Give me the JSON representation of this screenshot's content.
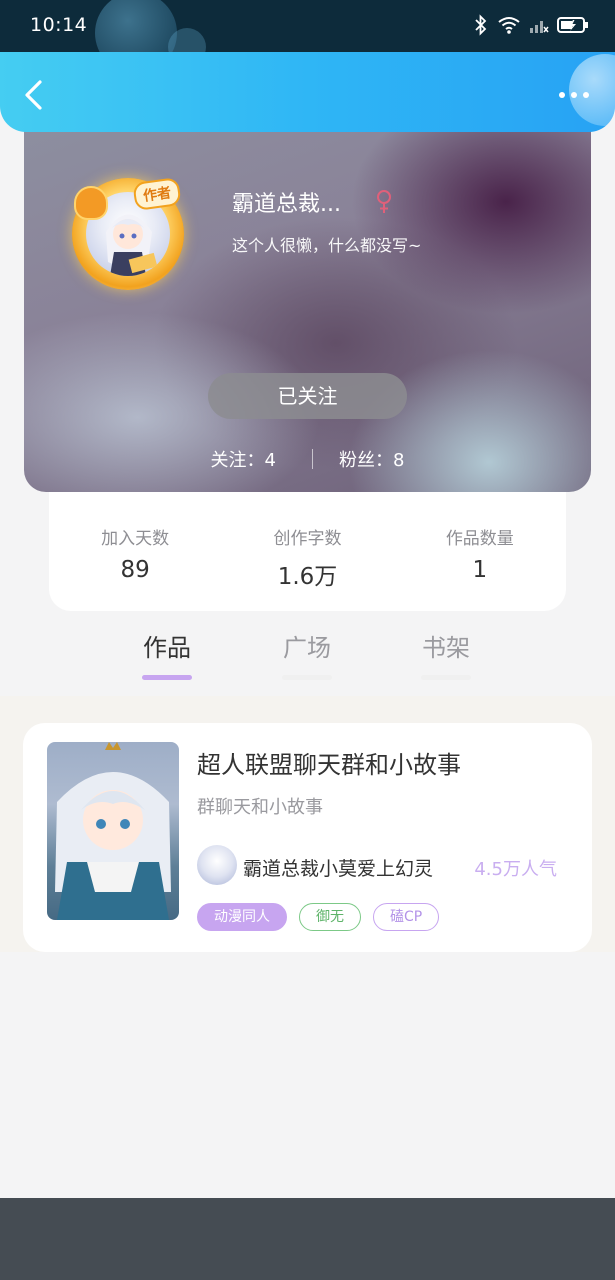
{
  "status_bar": {
    "time": "10:14"
  },
  "profile": {
    "nickname": "霸道总裁...",
    "bio": "这个人很懒，什么都没写~",
    "author_badge": "作者",
    "follow_button": "已关注",
    "following_text": "关注：4",
    "followers_text": "粉丝：8"
  },
  "stats": [
    {
      "label": "加入天数",
      "value": "89"
    },
    {
      "label": "创作字数",
      "value": "1.6万"
    },
    {
      "label": "作品数量",
      "value": "1"
    }
  ],
  "tabs": [
    {
      "label": "作品",
      "active": true
    },
    {
      "label": "广场",
      "active": false
    },
    {
      "label": "书架",
      "active": false
    }
  ],
  "work": {
    "title": "超人联盟聊天群和小故事",
    "subtitle": "群聊天和小故事",
    "author": "霸道总裁小莫爱上幻灵",
    "popularity": "4.5万人气",
    "tags": [
      "动漫同人",
      "御无",
      "磕CP"
    ]
  },
  "colors": {
    "header_gradient_start": "#45cdf2",
    "header_gradient_end": "#27a2f4",
    "accent_purple": "#c7a5f0",
    "tag_green": "#7cc987",
    "female_icon": "#e0607a"
  }
}
